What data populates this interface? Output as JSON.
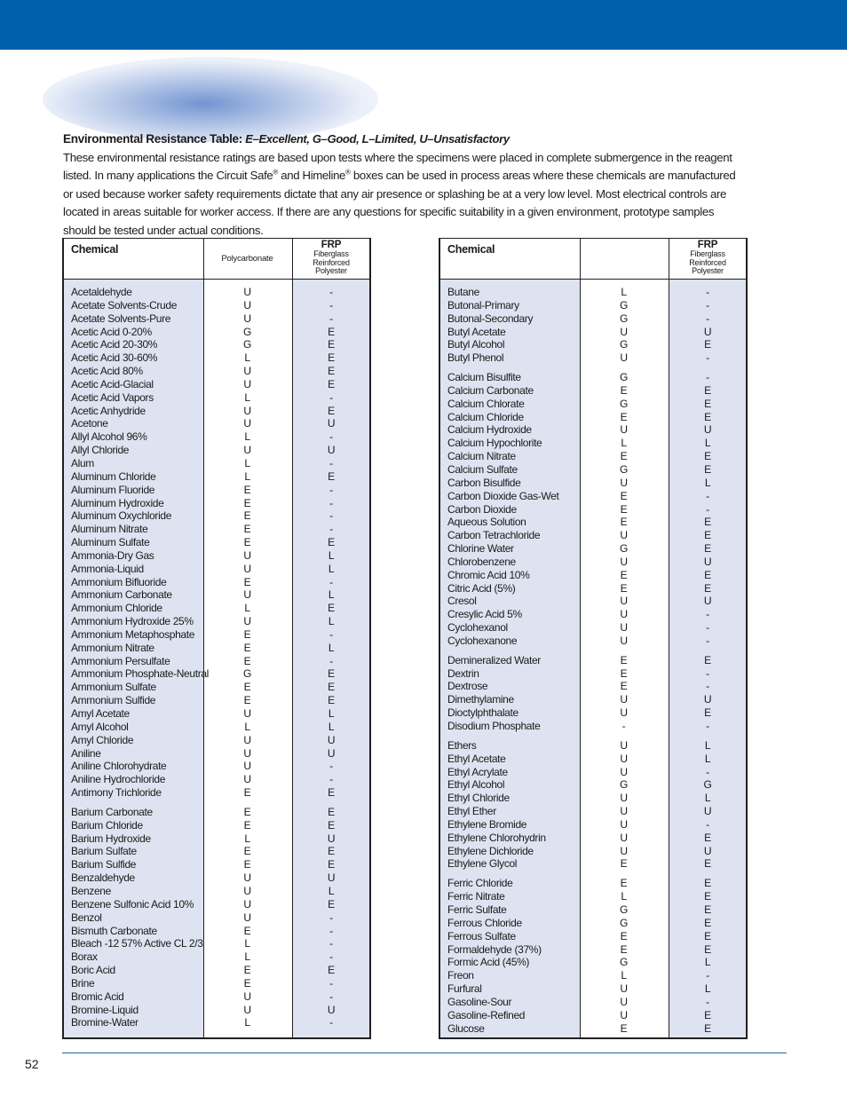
{
  "header": {
    "bar_color": "#005eaa"
  },
  "intro": {
    "title": "Environmental Resistance Table:",
    "legend": "E–Excellent, G–Good, L–Limited, U–Unsatisfactory",
    "text_part1": "These environmental resistance ratings are based upon tests where the specimens were placed in complete submergence in the reagent listed. In many applications the Circuit Safe",
    "reg1": "®",
    "text_part2": " and Himeline",
    "reg2": "®",
    "text_part3": " boxes can be used in process areas where these chemicals are manufactured or used because worker safety requirements dictate that any air presence or splashing be at a very low level. Most electrical controls are located in areas suitable for worker access. If there are any questions for specific suitability in a given environment, prototype samples should be tested under actual conditions."
  },
  "tables": [
    {
      "headers": {
        "chemical": "Chemical",
        "col2": "Polycarbonate",
        "frp": "FRP",
        "frp_sub1": "Fiberglass",
        "frp_sub2": "Reinforced",
        "frp_sub3": "Polyester"
      },
      "groups": [
        [
          [
            "Acetaldehyde",
            "U",
            "-"
          ],
          [
            "Acetate Solvents-Crude",
            "U",
            "-"
          ],
          [
            "Acetate Solvents-Pure",
            "U",
            "-"
          ],
          [
            "Acetic Acid 0-20%",
            "G",
            "E"
          ],
          [
            "Acetic Acid 20-30%",
            "G",
            "E"
          ],
          [
            "Acetic Acid 30-60%",
            "L",
            "E"
          ],
          [
            "Acetic Acid 80%",
            "U",
            "E"
          ],
          [
            "Acetic Acid-Glacial",
            "U",
            "E"
          ],
          [
            "Acetic Acid Vapors",
            "L",
            "-"
          ],
          [
            "Acetic Anhydride",
            "U",
            "E"
          ],
          [
            "Acetone",
            "U",
            "U"
          ],
          [
            "Allyl Alcohol 96%",
            "L",
            "-"
          ],
          [
            "Allyl Chloride",
            "U",
            "U"
          ],
          [
            "Alum",
            "L",
            "-"
          ],
          [
            "Aluminum Chloride",
            "L",
            "E"
          ],
          [
            "Aluminum Fluoride",
            "E",
            "-"
          ],
          [
            "Aluminum Hydroxide",
            "E",
            "-"
          ],
          [
            "Aluminum Oxychloride",
            "E",
            "-"
          ],
          [
            "Aluminum Nitrate",
            "E",
            "-"
          ],
          [
            "Aluminum Sulfate",
            "E",
            "E"
          ],
          [
            "Ammonia-Dry Gas",
            "U",
            "L"
          ],
          [
            "Ammonia-Liquid",
            "U",
            "L"
          ],
          [
            "Ammonium Bifluoride",
            "E",
            "-"
          ],
          [
            "Ammonium Carbonate",
            "U",
            "L"
          ],
          [
            "Ammonium Chloride",
            "L",
            "E"
          ],
          [
            "Ammonium Hydroxide 25%",
            "U",
            "L"
          ],
          [
            "Ammonium Metaphosphate",
            "E",
            "-"
          ],
          [
            "Ammonium Nitrate",
            "E",
            "L"
          ],
          [
            "Ammonium Persulfate",
            "E",
            "-"
          ],
          [
            "Ammonium Phosphate-Neutral",
            "G",
            "E"
          ],
          [
            "Ammonium Sulfate",
            "E",
            "E"
          ],
          [
            "Ammonium Sulfide",
            "E",
            "E"
          ],
          [
            "Amyl Acetate",
            "U",
            "L"
          ],
          [
            "Amyl Alcohol",
            "L",
            "L"
          ],
          [
            "Amyl Chloride",
            "U",
            "U"
          ],
          [
            "Aniline",
            "U",
            "U"
          ],
          [
            "Aniline Chlorohydrate",
            "U",
            "-"
          ],
          [
            "Aniline Hydrochloride",
            "U",
            "-"
          ],
          [
            "Antimony Trichloride",
            "E",
            "E"
          ]
        ],
        [
          [
            "Barium Carbonate",
            "E",
            "E"
          ],
          [
            "Barium Chloride",
            "E",
            "E"
          ],
          [
            "Barium Hydroxide",
            "L",
            "U"
          ],
          [
            "Barium Sulfate",
            "E",
            "E"
          ],
          [
            "Barium Sulfide",
            "E",
            "E"
          ],
          [
            "Benzaldehyde",
            "U",
            "U"
          ],
          [
            "Benzene",
            "U",
            "L"
          ],
          [
            "Benzene Sulfonic Acid 10%",
            "U",
            "E"
          ],
          [
            "Benzol",
            "U",
            "-"
          ],
          [
            "Bismuth Carbonate",
            "E",
            "-"
          ],
          [
            "Bleach -12 57% Active CL 2/3",
            "L",
            "-"
          ],
          [
            "Borax",
            "L",
            "-"
          ],
          [
            "Boric Acid",
            "E",
            "E"
          ],
          [
            "Brine",
            "E",
            "-"
          ],
          [
            "Bromic Acid",
            "U",
            "-"
          ],
          [
            "Bromine-Liquid",
            "U",
            "U"
          ],
          [
            "Bromine-Water",
            "L",
            "-"
          ]
        ]
      ]
    },
    {
      "headers": {
        "chemical": "Chemical",
        "col2": "",
        "frp": "FRP",
        "frp_sub1": "Fiberglass",
        "frp_sub2": "Reinforced",
        "frp_sub3": "Polyester"
      },
      "groups": [
        [
          [
            "Butane",
            "L",
            "-"
          ],
          [
            "Butonal-Primary",
            "G",
            "-"
          ],
          [
            "Butonal-Secondary",
            "G",
            "-"
          ],
          [
            "Butyl Acetate",
            "U",
            "U"
          ],
          [
            "Butyl Alcohol",
            "G",
            "E"
          ],
          [
            "Butyl Phenol",
            "U",
            "-"
          ]
        ],
        [
          [
            "Calcium Bisulfite",
            "G",
            "-"
          ],
          [
            "Calcium Carbonate",
            "E",
            "E"
          ],
          [
            "Calcium Chlorate",
            "G",
            "E"
          ],
          [
            "Calcium Chloride",
            "E",
            "E"
          ],
          [
            "Calcium Hydroxide",
            "U",
            "U"
          ],
          [
            "Calcium Hypochlorite",
            "L",
            "L"
          ],
          [
            "Calcium Nitrate",
            "E",
            "E"
          ],
          [
            "Calcium Sulfate",
            "G",
            "E"
          ],
          [
            "Carbon Bisulfide",
            "U",
            "L"
          ],
          [
            "Carbon Dioxide Gas-Wet",
            "E",
            "-"
          ],
          [
            "Carbon Dioxide",
            "E",
            "-"
          ],
          [
            "Aqueous Solution",
            "E",
            "E"
          ],
          [
            "Carbon Tetrachloride",
            "U",
            "E"
          ],
          [
            "Chlorine Water",
            "G",
            "E"
          ],
          [
            "Chlorobenzene",
            "U",
            "U"
          ],
          [
            "Chromic Acid 10%",
            "E",
            "E"
          ],
          [
            "Citric Acid (5%)",
            "E",
            "E"
          ],
          [
            "Cresol",
            "U",
            "U"
          ],
          [
            "Cresylic Acid 5%",
            "U",
            "-"
          ],
          [
            "Cyclohexanol",
            "U",
            "-"
          ],
          [
            "Cyclohexanone",
            "U",
            "-"
          ]
        ],
        [
          [
            "Demineralized Water",
            "E",
            "E"
          ],
          [
            "Dextrin",
            "E",
            "-"
          ],
          [
            "Dextrose",
            "E",
            "-"
          ],
          [
            "Dimethylamine",
            "U",
            "U"
          ],
          [
            "Dioctylphthalate",
            "U",
            "E"
          ],
          [
            "Disodium Phosphate",
            "-",
            "-"
          ]
        ],
        [
          [
            "Ethers",
            "U",
            "L"
          ],
          [
            "Ethyl Acetate",
            "U",
            "L"
          ],
          [
            "Ethyl Acrylate",
            "U",
            "-"
          ],
          [
            "Ethyl Alcohol",
            "G",
            "G"
          ],
          [
            "Ethyl Chloride",
            "U",
            "L"
          ],
          [
            "Ethyl Ether",
            "U",
            "U"
          ],
          [
            "Ethylene Bromide",
            "U",
            "-"
          ],
          [
            "Ethylene Chlorohydrin",
            "U",
            "E"
          ],
          [
            "Ethylene Dichloride",
            "U",
            "U"
          ],
          [
            "Ethylene Glycol",
            "E",
            "E"
          ]
        ],
        [
          [
            "Ferric Chloride",
            "E",
            "E"
          ],
          [
            "Ferric Nitrate",
            "L",
            "E"
          ],
          [
            "Ferric Sulfate",
            "G",
            "E"
          ],
          [
            "Ferrous Chloride",
            "G",
            "E"
          ],
          [
            "Ferrous Sulfate",
            "E",
            "E"
          ],
          [
            "Formaldehyde (37%)",
            "E",
            "E"
          ],
          [
            "Formic Acid (45%)",
            "G",
            "L"
          ],
          [
            "Freon",
            "L",
            "-"
          ],
          [
            "Furfural",
            "U",
            "L"
          ],
          [
            "Gasoline-Sour",
            "U",
            "-"
          ],
          [
            "Gasoline-Refined",
            "U",
            "E"
          ],
          [
            "Glucose",
            "E",
            "E"
          ]
        ]
      ]
    }
  ],
  "footer": {
    "page_number": "52",
    "rule_color": "#1d64a6"
  }
}
